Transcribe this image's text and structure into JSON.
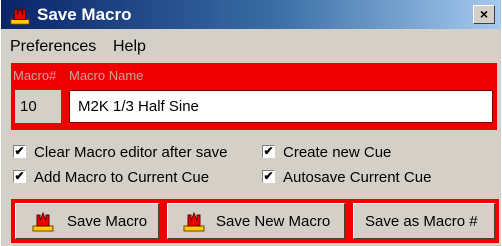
{
  "window": {
    "title": "Save Macro",
    "close_glyph": "×"
  },
  "menu": {
    "items": [
      {
        "label": "Preferences"
      },
      {
        "label": "Help"
      }
    ]
  },
  "macro": {
    "number_label": "Macro#",
    "name_label": "Macro Name",
    "number_value": "10",
    "name_value": "M2K 1/3 Half Sine",
    "panel_color": "#ee0000"
  },
  "options": [
    {
      "label": "Clear Macro editor after save",
      "checked": true
    },
    {
      "label": "Create new Cue",
      "checked": true
    },
    {
      "label": "Add Macro to Current Cue",
      "checked": true
    },
    {
      "label": "Autosave Current Cue",
      "checked": true
    }
  ],
  "buttons": {
    "save": {
      "label": "Save Macro",
      "icon": "macro-icon"
    },
    "save_new": {
      "label": "Save New Macro",
      "icon": "macro-icon"
    },
    "save_as": {
      "label": "Save as Macro #"
    }
  },
  "icons": {
    "title": "macro-icon",
    "checkmark": "✔"
  }
}
